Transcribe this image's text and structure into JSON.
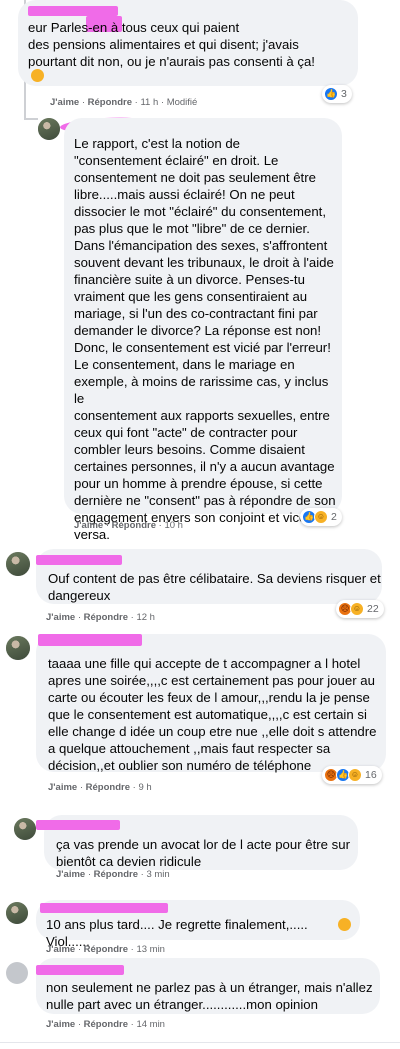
{
  "colors": {
    "bubble": "#f0f2f5",
    "text": "#050505",
    "meta": "#65676b",
    "redaction": "#f06be8",
    "like": "#1877f2"
  },
  "actions": {
    "like": "J'aime",
    "reply": "Répondre"
  },
  "comments": [
    {
      "text": "eur Parles-en à tous ceux qui paient\ndes pensions alimentaires et qui disent; j'avais\npourtant dit non, ou je n'aurais pas consenti à ça!",
      "time": "11 h",
      "edited": "Modifié",
      "reactions": {
        "icons": [
          "like"
        ],
        "count": "3"
      }
    },
    {
      "text": "Le rapport, c'est la notion de\n\"consentement éclairé\" en droit. Le\nconsentement ne doit pas seulement être\nlibre.....mais aussi éclairé! On ne peut\ndissocier le mot \"éclairé\" du consentement,\npas plus que le mot \"libre\" de ce dernier.\nDans l'émancipation des sexes, s'affrontent\nsouvent devant les tribunaux, le droit à l'aide\nfinancière suite à un divorce. Penses-tu\nvraiment que les gens consentiraient au\nmariage, si l'un des co-contractant fini par\ndemander le divorce? La réponse est non!\nDonc, le consentement est vicié par l'erreur!\nLe consentement, dans le mariage en\nexemple, à moins de rarissime cas, y inclus le\nconsentement aux rapports sexuelles, entre\nceux qui font \"acte\" de contracter pour\ncombler leurs besoins. Comme disaient\ncertaines personnes, il n'y a aucun avantage\npour un homme à prendre épouse, si cette\ndernière ne \"consent\" pas à répondre de son\nengagement envers son conjoint et vice\nversa.",
      "time": "10 h",
      "reactions": {
        "icons": [
          "like",
          "haha"
        ],
        "count": "2"
      }
    },
    {
      "text": "Ouf content de pas être célibataire. Sa deviens risquer et\ndangereux",
      "time": "12 h",
      "reactions": {
        "icons": [
          "angry",
          "haha"
        ],
        "count": "22"
      }
    },
    {
      "text": "taaaa une fille qui accepte de t accompagner a l hotel\napres une soirée,,,,c est certainement pas pour jouer au\ncarte ou écouter les feux de l amour,,,rendu la je pense\nque le consentement est automatique,,,,c est certain si\nelle change d idée un coup etre nue ,,elle doit s attendre\na quelque attouchement ,,mais faut respecter sa\ndécision,,et oublier son numéro de téléphone",
      "time": "9 h",
      "reactions": {
        "icons": [
          "angry",
          "like",
          "haha"
        ],
        "count": "16"
      }
    },
    {
      "text": "ça vas prende un avocat lor de l acte pour être sur\nbientôt ca devien ridicule",
      "time": "3 min"
    },
    {
      "text": "10 ans plus tard.... Je regrette finalement,..... Viol......",
      "time": "13 min"
    },
    {
      "text": "non seulement ne parlez pas à un étranger, mais n'allez\nnulle part avec un étranger............mon opinion",
      "time": "14 min"
    }
  ]
}
